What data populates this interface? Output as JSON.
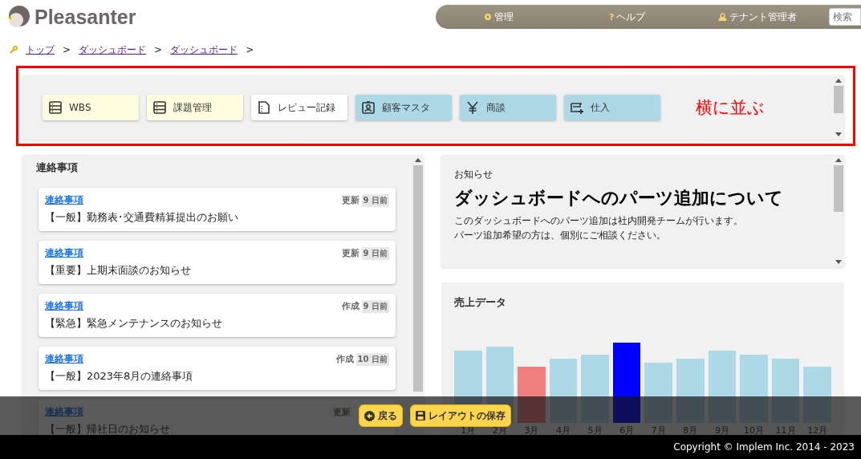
{
  "app": {
    "logo_text": "Pleasanter"
  },
  "nav": {
    "items": [
      {
        "label": "管理"
      },
      {
        "label": "ヘルプ",
        "icon_text": "?"
      },
      {
        "label": "テナント管理者"
      }
    ],
    "search": {
      "placeholder": "検索"
    }
  },
  "breadcrumb": [
    "トップ",
    "ダッシュボード",
    "ダッシュボード"
  ],
  "breadcrumb_separator": ">",
  "quick_links": {
    "items": [
      {
        "label": "WBS",
        "color": "#fffde0"
      },
      {
        "label": "課題管理",
        "color": "#fffde0"
      },
      {
        "label": "レビュー記録",
        "color": "#ffffff"
      },
      {
        "label": "顧客マスタ",
        "color": "#add8e6"
      },
      {
        "label": "商談",
        "color": "#add8e6"
      },
      {
        "label": "仕入",
        "color": "#add8e6"
      }
    ],
    "annotation": "横に並ぶ"
  },
  "notices": {
    "title": "連絡事項",
    "items": [
      {
        "link": "連絡事項",
        "action": "更新",
        "age": "9 日前",
        "title": "【一般】勤務表･交通費精算提出のお願い"
      },
      {
        "link": "連絡事項",
        "action": "更新",
        "age": "9 日前",
        "title": "【重要】上期末面談のお知らせ"
      },
      {
        "link": "連絡事項",
        "action": "作成",
        "age": "9 日前",
        "title": "【緊急】緊急メンテナンスのお知らせ"
      },
      {
        "link": "連絡事項",
        "action": "作成",
        "age": "10 日前",
        "title": "【一般】2023年8月の連絡事項"
      },
      {
        "link": "連絡事項",
        "action": "更新",
        "title": "【一般】帰社日のお知らせ"
      }
    ]
  },
  "announcement": {
    "label": "お知らせ",
    "heading": "ダッシュボードへのパーツ追加について",
    "lines": [
      "このダッシュボードへのパーツ追加は社内開発チームが行います。",
      "パーツ追加希望の方は、個別にご相談ください。"
    ]
  },
  "sales": {
    "title": "売上データ",
    "months": [
      {
        "label": "1月",
        "color": "#add8e6"
      },
      {
        "label": "2月",
        "color": "#add8e6"
      },
      {
        "label": "3月",
        "color": "#f08080"
      },
      {
        "label": "4月",
        "color": "#add8e6"
      },
      {
        "label": "5月",
        "color": "#add8e6"
      },
      {
        "label": "6月",
        "color": "#0000ff"
      },
      {
        "label": "7月",
        "color": "#add8e6"
      },
      {
        "label": "8月",
        "color": "#add8e6"
      },
      {
        "label": "9月",
        "color": "#add8e6"
      },
      {
        "label": "10月",
        "color": "#add8e6"
      },
      {
        "label": "11月",
        "color": "#add8e6"
      },
      {
        "label": "12月",
        "color": "#add8e6"
      }
    ]
  },
  "actions": [
    {
      "label": "戻る"
    },
    {
      "label": "レイアウトの保存"
    }
  ],
  "footer": {
    "copyright": "Copyright © Implem Inc. 2014 - 2023"
  }
}
